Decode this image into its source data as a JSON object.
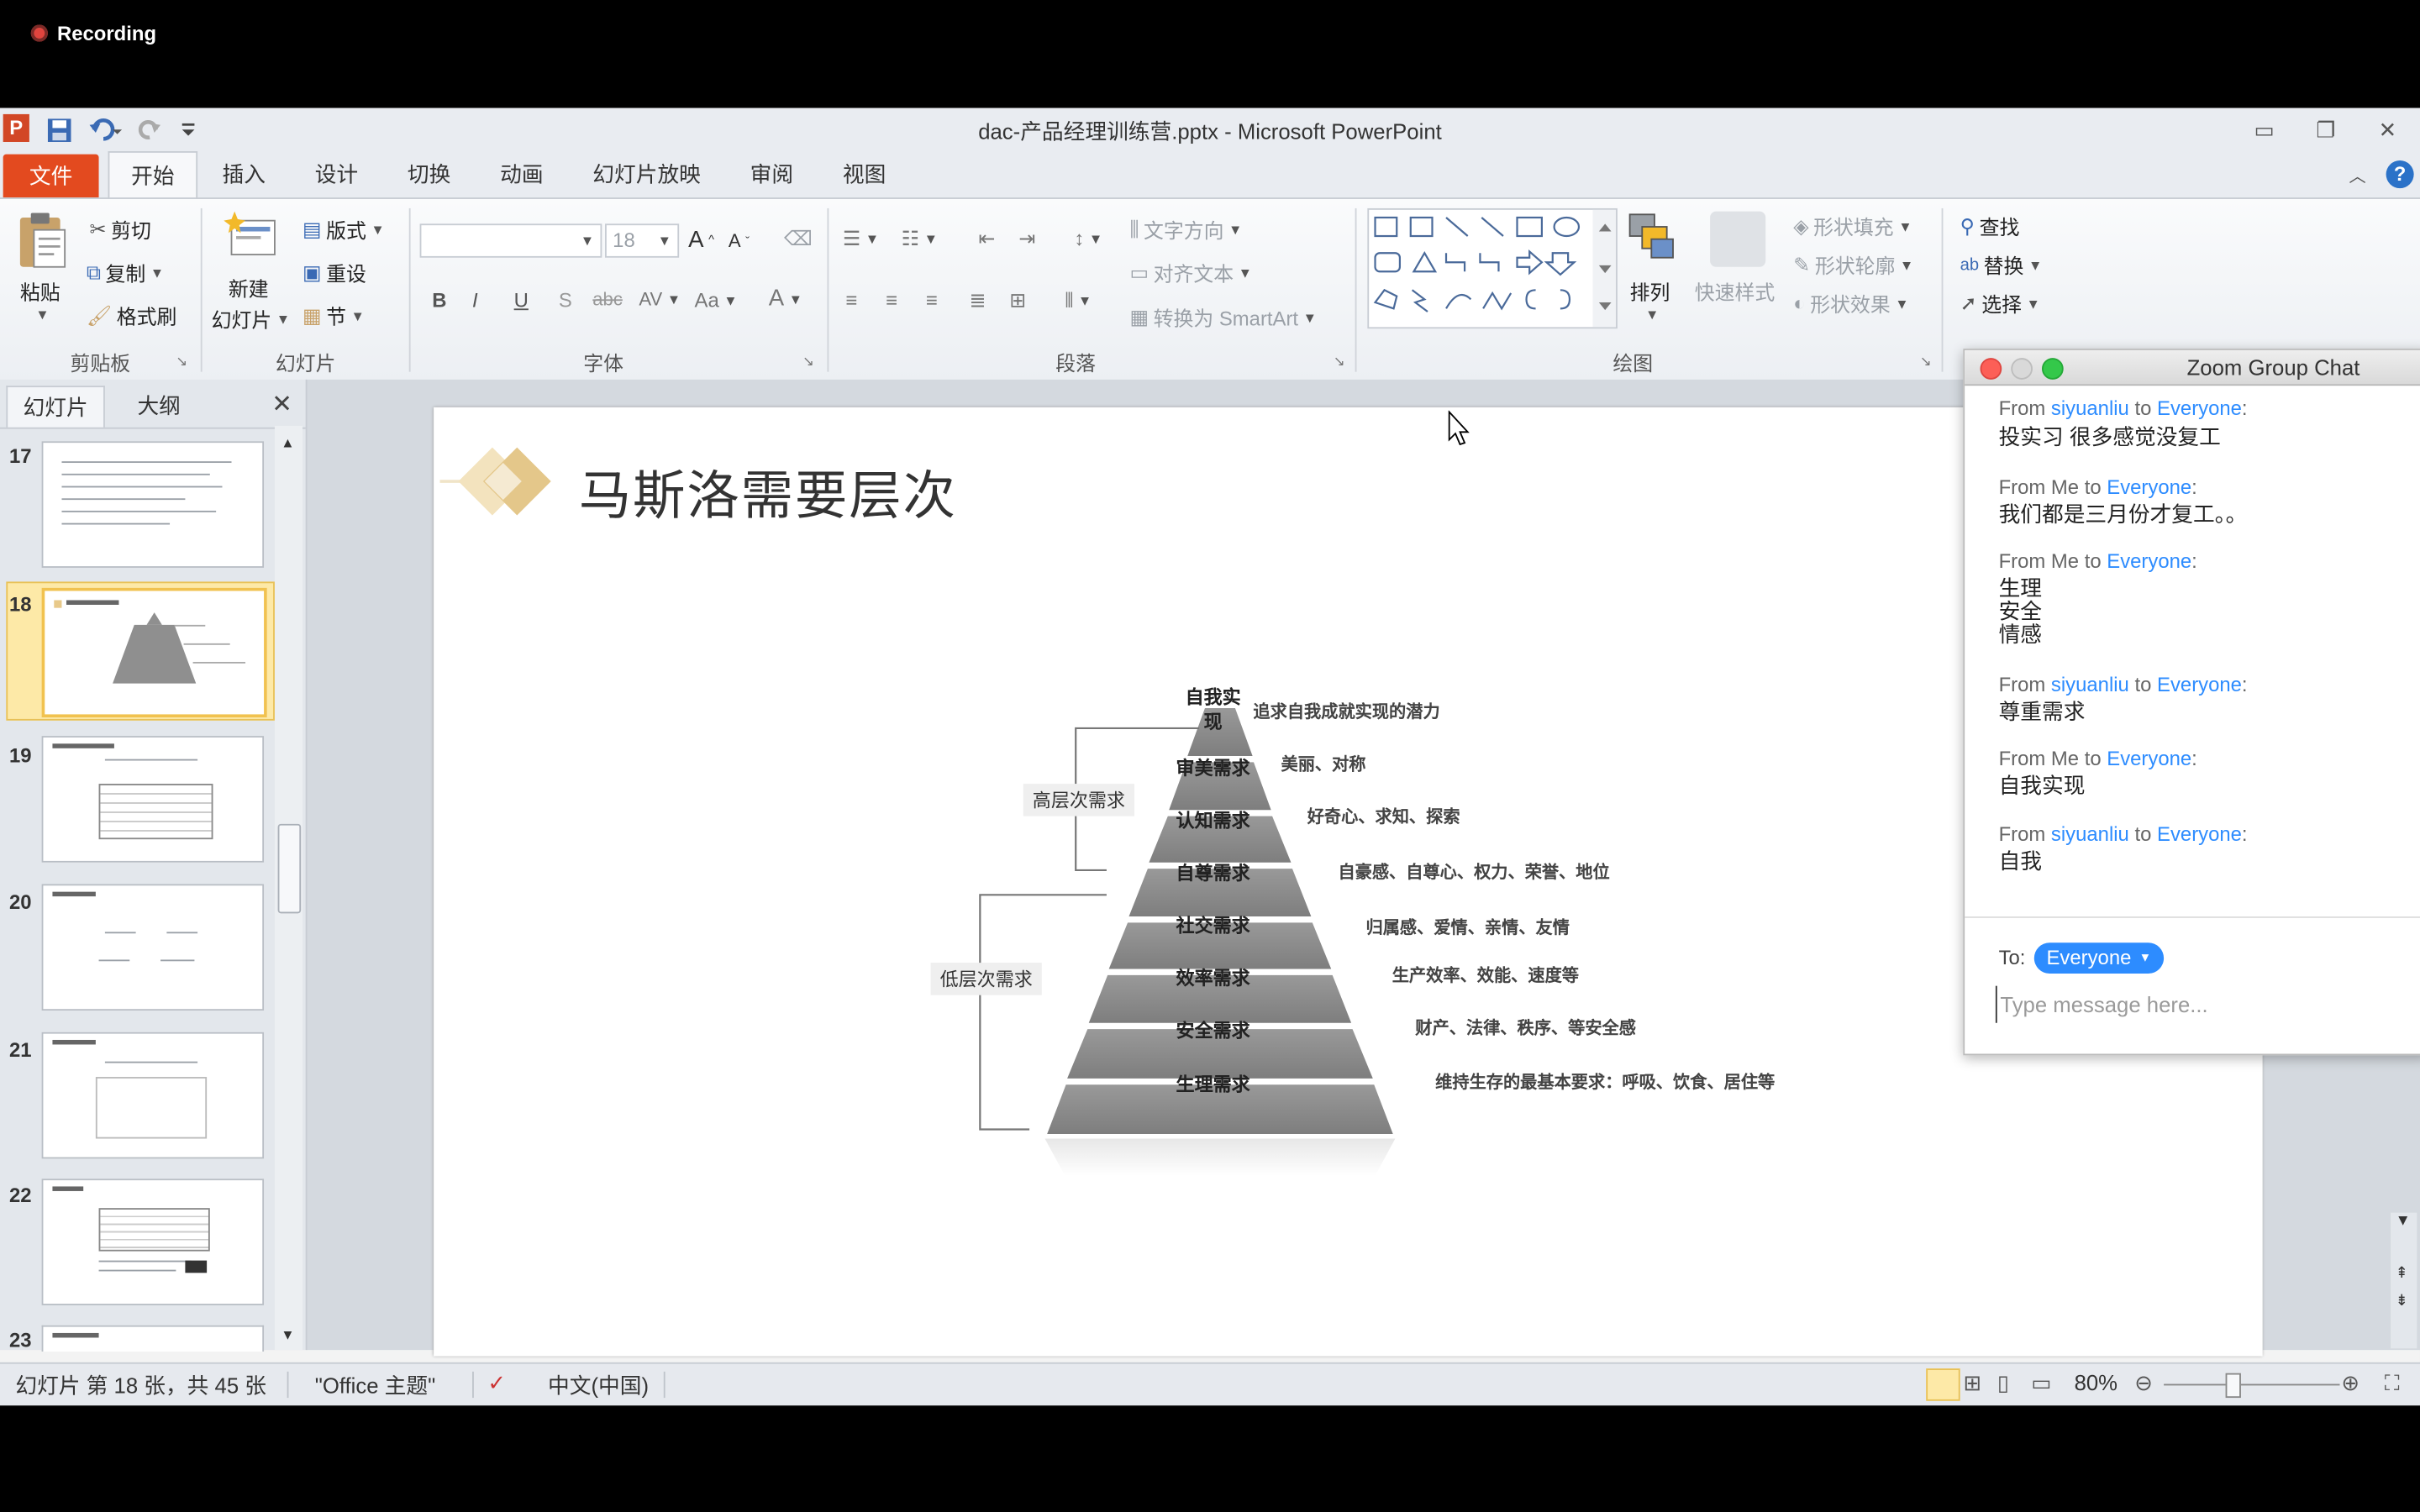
{
  "recording": {
    "label": "Recording"
  },
  "window": {
    "title": "dac-产品经理训练营.pptx - Microsoft PowerPoint",
    "tabs": [
      "文件",
      "开始",
      "插入",
      "设计",
      "切换",
      "动画",
      "幻灯片放映",
      "审阅",
      "视图"
    ],
    "active_tab": "开始"
  },
  "ribbon": {
    "clipboard": {
      "paste": "粘贴",
      "cut": "剪切",
      "copy": "复制",
      "format_painter": "格式刷",
      "group": "剪贴板"
    },
    "slides": {
      "new_slide": "新建",
      "new_slide_2": "幻灯片",
      "layout": "版式",
      "reset": "重设",
      "section": "节",
      "group": "幻灯片"
    },
    "font": {
      "size": "18",
      "bold": "B",
      "italic": "I",
      "underline": "U",
      "shadow": "S",
      "strike": "abc",
      "group": "字体"
    },
    "paragraph": {
      "text_direction": "文字方向",
      "align_text": "对齐文本",
      "convert_smartart": "转换为 SmartArt",
      "group": "段落"
    },
    "drawing": {
      "arrange": "排列",
      "quick_styles": "快速样式",
      "shape_fill": "形状填充",
      "shape_outline": "形状轮廓",
      "shape_effects": "形状效果",
      "group": "绘图"
    },
    "editing": {
      "find": "查找",
      "replace": "替换",
      "select": "选择"
    }
  },
  "left_pane": {
    "tabs": [
      "幻灯片",
      "大纲"
    ],
    "slide_numbers": [
      "17",
      "18",
      "19",
      "20",
      "21",
      "22",
      "23"
    ],
    "selected": "18"
  },
  "slide": {
    "title": "马斯洛需要层次",
    "pyramid": [
      {
        "level": "自我实现",
        "desc": "追求自我成就实现的潜力"
      },
      {
        "level": "审美需求",
        "desc": "美丽、对称"
      },
      {
        "level": "认知需求",
        "desc": "好奇心、求知、探索"
      },
      {
        "level": "自尊需求",
        "desc": "自豪感、自尊心、权力、荣誉、地位"
      },
      {
        "level": "社交需求",
        "desc": "归属感、爱情、亲情、友情"
      },
      {
        "level": "效率需求",
        "desc": "生产效率、效能、速度等"
      },
      {
        "level": "安全需求",
        "desc": "财产、法律、秩序、等安全感"
      },
      {
        "level": "生理需求",
        "desc": "维持生存的最基本要求：呼吸、饮食、居住等"
      }
    ],
    "top_level_line1": "自我实",
    "top_level_line2": "现",
    "high_label": "高层次需求",
    "low_label": "低层次需求"
  },
  "status": {
    "slide_info": "幻灯片 第 18 张，共 45 张",
    "theme": "\"Office 主题\"",
    "language": "中文(中国)",
    "zoom": "80%"
  },
  "zoom_chat": {
    "title": "Zoom Group Chat",
    "messages": [
      {
        "from_prefix": "From ",
        "from": "siyuanliu",
        "to_word": " to ",
        "to": "Everyone",
        "text": "投实习 很多感觉没复工"
      },
      {
        "from_prefix": "From Me to ",
        "from": "",
        "to_word": "",
        "to": "Everyone",
        "text": "我们都是三月份才复工。。"
      },
      {
        "from_prefix": "From Me to ",
        "from": "",
        "to_word": "",
        "to": "Everyone",
        "text": "生理\n安全\n情感"
      },
      {
        "from_prefix": "From ",
        "from": "siyuanliu",
        "to_word": " to ",
        "to": "Everyone",
        "text": "尊重需求"
      },
      {
        "from_prefix": "From Me to ",
        "from": "",
        "to_word": "",
        "to": "Everyone",
        "text": "自我实现"
      },
      {
        "from_prefix": "From ",
        "from": "siyuanliu",
        "to_word": " to ",
        "to": "Everyone",
        "text": "自我"
      }
    ],
    "to_label": "To:",
    "recipient": "Everyone",
    "input_placeholder": "Type message here..."
  }
}
